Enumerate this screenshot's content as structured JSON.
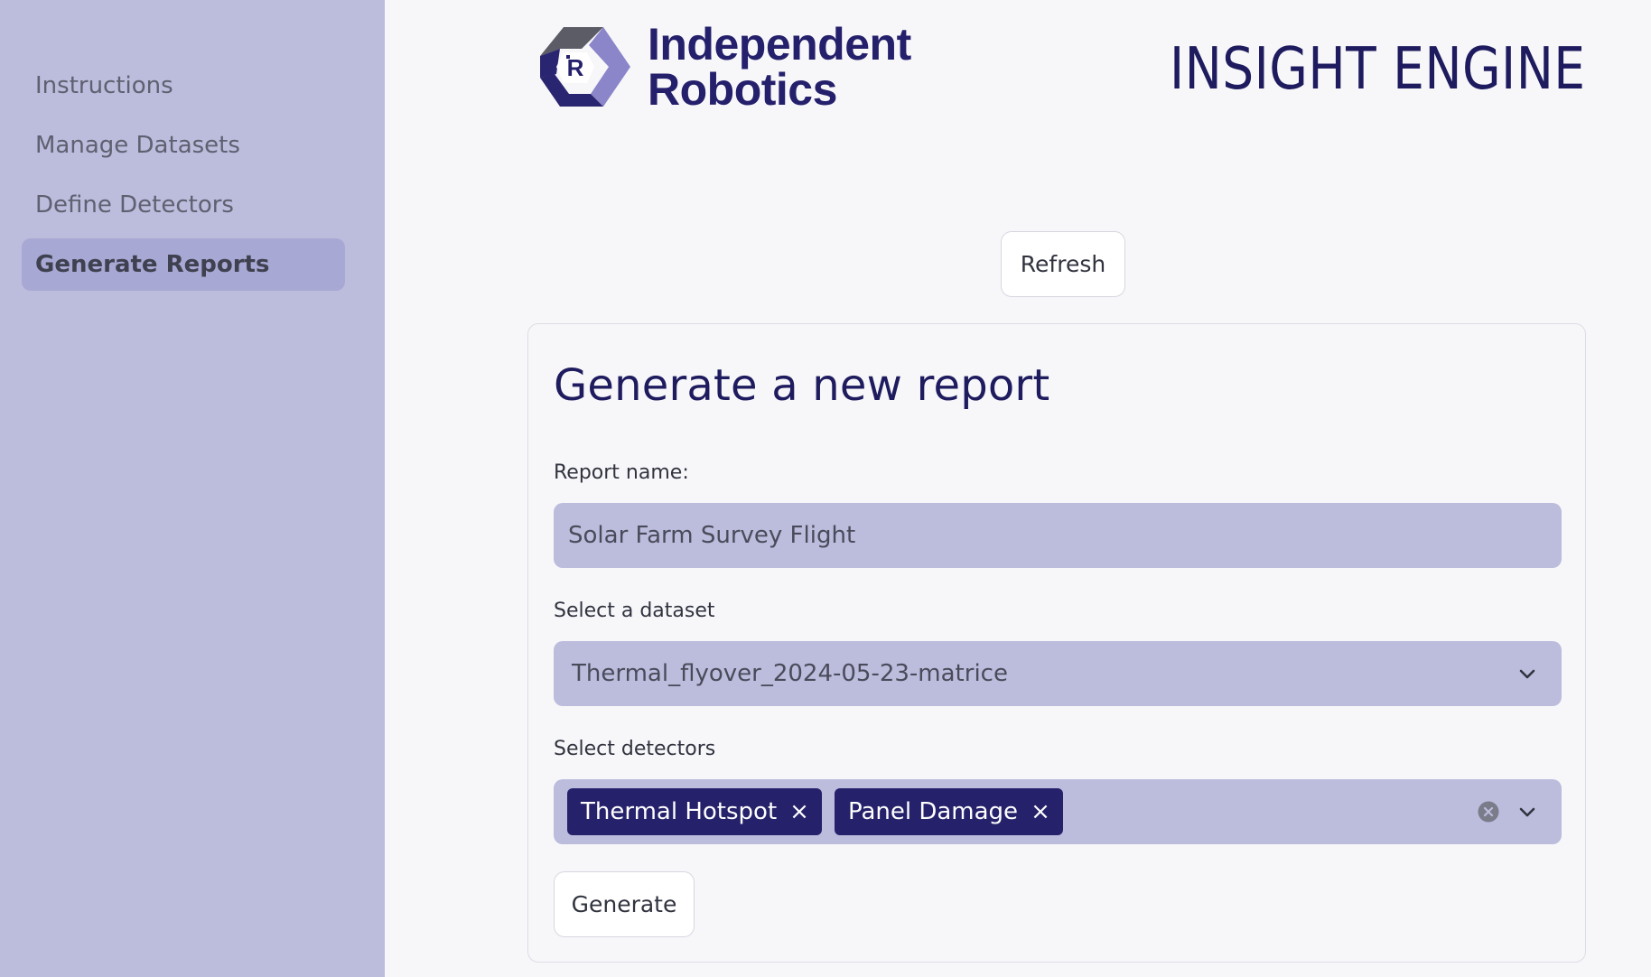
{
  "sidebar": {
    "items": [
      {
        "label": "Instructions",
        "active": false
      },
      {
        "label": "Manage Datasets",
        "active": false
      },
      {
        "label": "Define Detectors",
        "active": false
      },
      {
        "label": "Generate Reports",
        "active": true
      }
    ]
  },
  "header": {
    "logo": {
      "icon": "independent-robotics-logo-icon",
      "line1": "Independent",
      "line2": "Robotics"
    },
    "app_title": "INSIGHT ENGINE"
  },
  "toolbar": {
    "refresh_label": "Refresh"
  },
  "report_form": {
    "title": "Generate a new report",
    "report_name": {
      "label": "Report name:",
      "value": "Solar Farm Survey Flight"
    },
    "dataset": {
      "label": "Select a dataset",
      "selected": "Thermal_flyover_2024-05-23-matrice"
    },
    "detectors": {
      "label": "Select detectors",
      "selected": [
        "Thermal Hotspot",
        "Panel Damage"
      ],
      "remove_glyph": "×"
    },
    "generate_label": "Generate"
  },
  "colors": {
    "sidebar_bg": "#bcbcdd",
    "active_nav_bg": "#a8a8d4",
    "field_bg": "#bcbcdd",
    "chip_bg": "#25216b",
    "title_color": "#1e1b5e",
    "page_bg": "#f7f7fa"
  }
}
